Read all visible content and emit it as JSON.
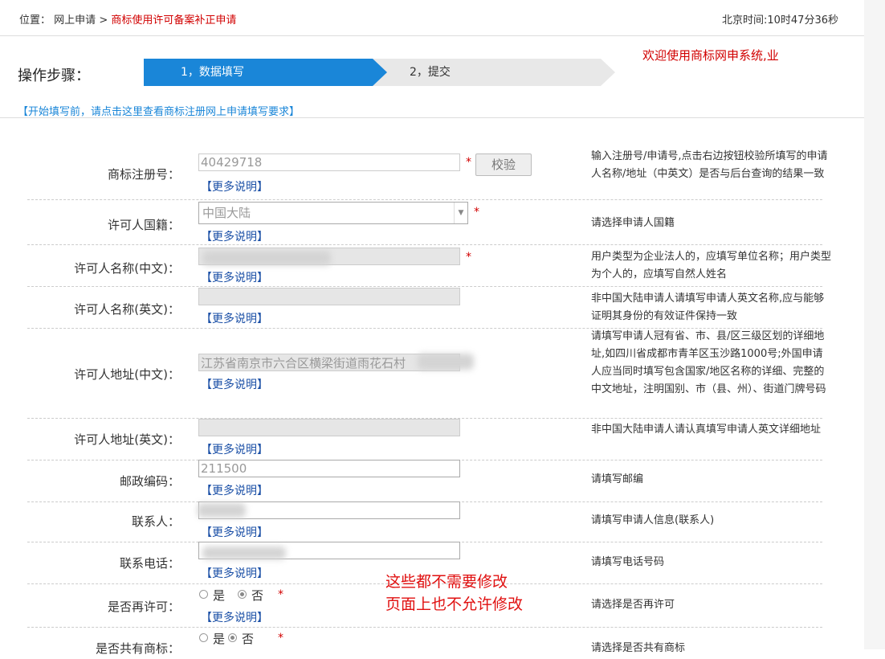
{
  "breadcrumb": {
    "prefix": "位置：",
    "home": "网上申请",
    "sep": ">",
    "current": "商标使用许可备案补正申请"
  },
  "clock": "北京时间:10时47分36秒",
  "steps": {
    "label": "操作步骤：",
    "items": [
      "1，数据填写",
      "2，提交"
    ]
  },
  "welcome": "欢迎使用商标网申系统,业",
  "req_link": "【开始填写前，请点击这里查看商标注册网上申请填写要求】",
  "more_label": "【更多说明】",
  "required_mark": "*",
  "verify_button": "校验",
  "fields": {
    "reg_no": {
      "label": "商标注册号：",
      "value": "40429718",
      "hint": "输入注册号/申请号,点击右边按钮校验所填写的申请人名称/地址（中英文）是否与后台查询的结果一致"
    },
    "nationality": {
      "label": "许可人国籍：",
      "value": "中国大陆",
      "hint": "请选择申请人国籍"
    },
    "name_cn": {
      "label": "许可人名称(中文)：",
      "value": "",
      "hint": "用户类型为企业法人的，应填写单位名称；用户类型为个人的，应填写自然人姓名"
    },
    "name_en": {
      "label": "许可人名称(英文)：",
      "value": "",
      "hint": "非中国大陆申请人请填写申请人英文名称,应与能够证明其身份的有效证件保持一致"
    },
    "addr_cn": {
      "label": "许可人地址(中文)：",
      "value": "江苏省南京市六合区横梁街道雨花石村",
      "hint": "请填写申请人冠有省、市、县/区三级区划的详细地址,如四川省成都市青羊区玉沙路1000号;外国申请人应当同时填写包含国家/地区名称的详细、完整的中文地址，注明国别、市（县、州）、街道门牌号码"
    },
    "addr_en": {
      "label": "许可人地址(英文)：",
      "value": "",
      "hint": "非中国大陆申请人请认真填写申请人英文详细地址"
    },
    "postcode": {
      "label": "邮政编码：",
      "value": "211500",
      "hint": "请填写邮编"
    },
    "contact": {
      "label": "联系人：",
      "value": "",
      "hint": "请填写申请人信息(联系人)"
    },
    "phone": {
      "label": "联系电话：",
      "value": "",
      "hint": "请填写电话号码"
    },
    "relicense": {
      "label": "是否再许可：",
      "yes": "是",
      "no": "否",
      "selected": "否",
      "hint": "请选择是否再许可"
    },
    "shared": {
      "label": "是否共有商标：",
      "yes": "是",
      "no": "否",
      "selected": "否",
      "hint": "请选择是否共有商标"
    }
  },
  "annotation": [
    "这些都不需要修改",
    "页面上也不允许修改"
  ]
}
